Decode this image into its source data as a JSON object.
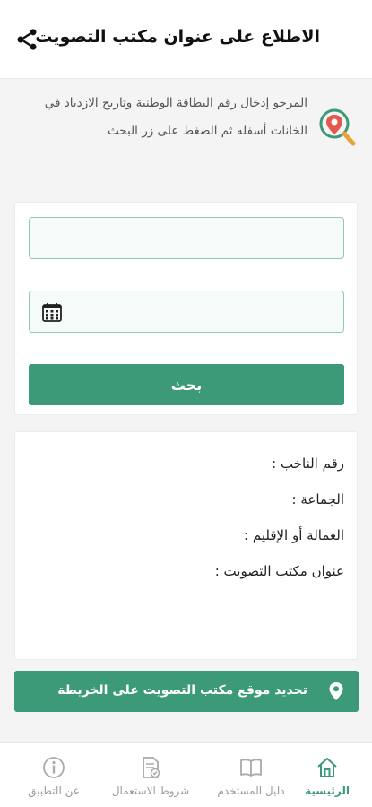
{
  "header": {
    "title": "الاطلاع على عنوان مكتب التصويت",
    "share_icon": "share-icon"
  },
  "intro": {
    "icon": "location-search-icon",
    "text": "المرجو إدخال رقم البطاقة الوطنية وتاريخ الازدياد في الخانات أسفله ثم الضغط على زر البحث"
  },
  "form": {
    "id_value": "",
    "id_placeholder": "",
    "date_value": "",
    "date_placeholder": "",
    "calendar_icon": "calendar-icon",
    "search_label": "بحث"
  },
  "result": {
    "voter_number": "رقم الناخب :",
    "commune": "الجماعة :",
    "prefecture": "العمالة أو الإقليم :",
    "office_address": "عنوان مكتب التصويت :"
  },
  "map_button": {
    "label": "تحديد موقع مكتب التصويت على الخريطة",
    "icon": "location-pin-icon"
  },
  "bottom_nav": {
    "items": [
      {
        "label": "الرئيسية",
        "icon": "home-icon",
        "active": true
      },
      {
        "label": "دليل المستخدم",
        "icon": "book-icon",
        "active": false
      },
      {
        "label": "شروط الاستعمال",
        "icon": "document-check-icon",
        "active": false
      },
      {
        "label": "عن التطبيق",
        "icon": "info-icon",
        "active": false
      }
    ]
  },
  "colors": {
    "accent": "#3c9a78",
    "input_border": "#8fc9b4",
    "input_bg": "#f4fbf8",
    "page_bg": "#f4f4f4"
  }
}
